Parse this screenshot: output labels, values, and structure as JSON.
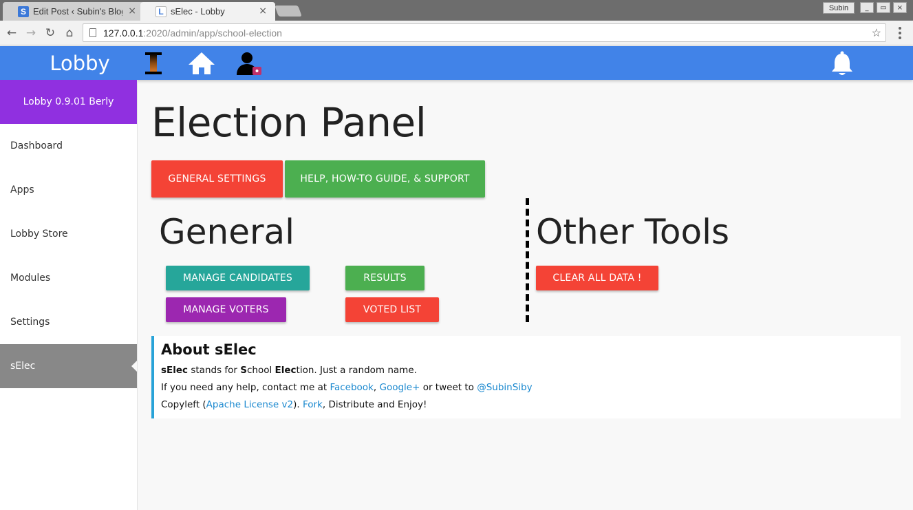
{
  "browser": {
    "tabs": [
      {
        "favicon": "S",
        "title": "Edit Post ‹ Subin's Blog",
        "close": "×"
      },
      {
        "favicon": "L",
        "title": "sElec - Lobby",
        "close": "×"
      }
    ],
    "user_button": "Subin",
    "window_buttons": {
      "minimize": "_",
      "maximize": "▭",
      "close": "×"
    },
    "url_host": "127.0.0.1",
    "url_path": ":2020/admin/app/school-election"
  },
  "header": {
    "brand": "Lobby",
    "icons": [
      "app-logo-icon",
      "home-icon",
      "admin-user-icon",
      "bell-icon"
    ],
    "accent_color": "#4183e8"
  },
  "sidebar": {
    "version": "Lobby 0.9.01 Berly",
    "items": [
      {
        "label": "Dashboard"
      },
      {
        "label": "Apps"
      },
      {
        "label": "Lobby Store"
      },
      {
        "label": "Modules"
      },
      {
        "label": "Settings"
      },
      {
        "label": "sElec",
        "active": true
      }
    ]
  },
  "main": {
    "title": "Election Panel",
    "top_buttons": {
      "settings": "General Settings",
      "help": "Help, How-To Guide, & Support"
    },
    "general": {
      "title": "General",
      "manage_candidates": "Manage Candidates",
      "manage_voters": "Manage Voters",
      "results": "Results",
      "voted_list": "Voted List"
    },
    "other_tools": {
      "title": "Other Tools",
      "clear_all": "Clear All Data !"
    },
    "about": {
      "title": "About sElec",
      "line1": {
        "b1": "sElec",
        "t1": " stands for ",
        "b2": "S",
        "t2": "chool ",
        "b3": "Elec",
        "t3": "tion. Just a random name."
      },
      "line2": {
        "t1": "If you need any help, contact me at ",
        "link1": "Facebook",
        "t2": ", ",
        "link2": "Google+",
        "t3": " or tweet to ",
        "link3": "@SubinSiby"
      },
      "line3": {
        "t1": "Copyleft (",
        "link1": "Apache License v2",
        "t2": "). ",
        "link2": "Fork",
        "t3": ", Distribute and Enjoy!"
      }
    }
  }
}
